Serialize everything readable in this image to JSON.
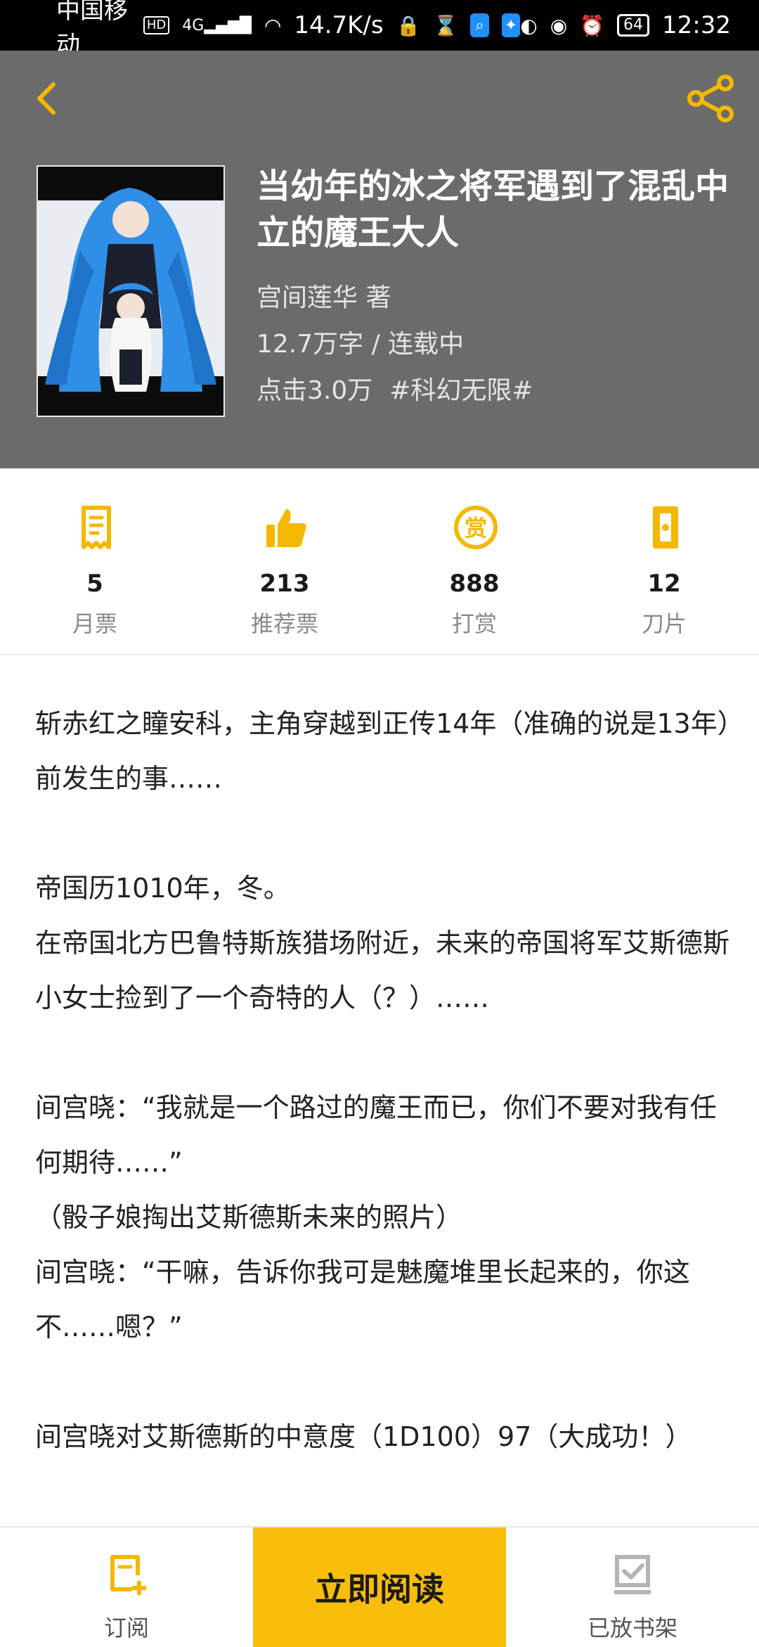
{
  "status_bar": {
    "carrier": "中国移动",
    "hd_badge": "HD",
    "signal_text": "4G",
    "speed": "14.7K/s",
    "battery": "64",
    "time": "12:32"
  },
  "book": {
    "title": "当幼年的冰之将军遇到了混乱中立的魔王大人",
    "author": "宫间莲华  著",
    "word_count_status": "12.7万字 / 连载中",
    "clicks": "点击3.0万",
    "tag": "#科幻无限#"
  },
  "stats": [
    {
      "value": "5",
      "label": "月票",
      "icon": "ticket-icon"
    },
    {
      "value": "213",
      "label": "推荐票",
      "icon": "thumbs-up-icon"
    },
    {
      "value": "888",
      "label": "打赏",
      "icon": "reward-coin-icon"
    },
    {
      "value": "12",
      "label": "刀片",
      "icon": "blade-icon"
    }
  ],
  "description": [
    "斩赤红之瞳安科，主角穿越到正传14年（准确的说是13年）前发生的事……",
    "",
    "帝国历1010年，冬。",
    "在帝国北方巴鲁特斯族猎场附近，未来的帝国将军艾斯德斯小女士捡到了一个奇特的人（？）……",
    "",
    "间宫晓：“我就是一个路过的魔王而已，你们不要对我有任何期待……”",
    "（骰子娘掏出艾斯德斯未来的照片）",
    "间宫晓：“干嘛，告诉你我可是魅魔堆里长起来的，你这不……嗯？”",
    "",
    "间宫晓对艾斯德斯的中意度（1D100）97（大成功！）"
  ],
  "bottom_bar": {
    "subscribe_label": "订阅",
    "read_label": "立即阅读",
    "shelf_label": "已放书架"
  },
  "colors": {
    "accent": "#f9bd0b",
    "header_bg": "#6b6b6b",
    "icon_yellow": "#f5b800"
  }
}
